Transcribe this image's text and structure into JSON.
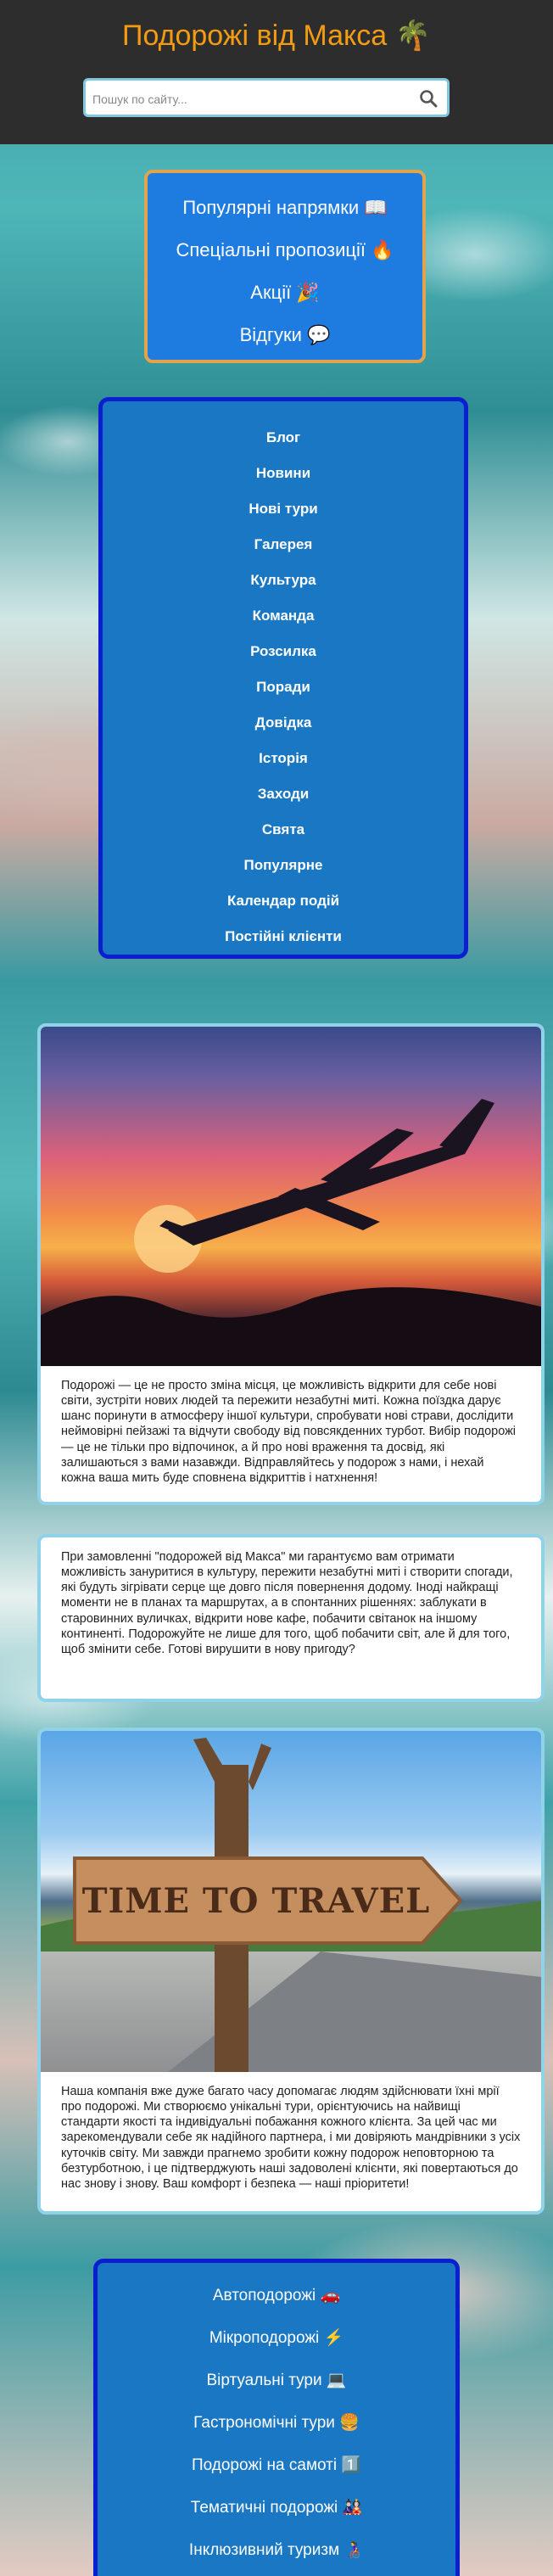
{
  "header": {
    "title": "Подорожі від Макса 🌴",
    "search_placeholder": "Пошук по сайту..."
  },
  "highlights": [
    {
      "label": "Популярні напрямки 📖"
    },
    {
      "label": "Спеціальні пропозиції 🔥"
    },
    {
      "label": "Акції 🎉"
    },
    {
      "label": "Відгуки 💬"
    }
  ],
  "nav": [
    {
      "label": "Блог"
    },
    {
      "label": "Новини"
    },
    {
      "label": "Нові тури"
    },
    {
      "label": "Галерея"
    },
    {
      "label": "Культура"
    },
    {
      "label": "Команда"
    },
    {
      "label": "Розсилка"
    },
    {
      "label": "Поради"
    },
    {
      "label": "Довідка"
    },
    {
      "label": "Історія"
    },
    {
      "label": "Заходи"
    },
    {
      "label": "Свята"
    },
    {
      "label": "Популярне"
    },
    {
      "label": "Календар подій"
    },
    {
      "label": "Постійні клієнти"
    }
  ],
  "cards": {
    "card1_text": "Подорожі — це не просто зміна місця, це можливість відкрити для себе нові світи, зустріти нових людей та пережити незабутні миті. Кожна поїздка дарує шанс поринути в атмосферу іншої культури, спробувати нові страви, дослідити неймовірні пейзажі та відчути свободу від повсякденних турбот. Вибір подорожі — це не тільки про відпочинок, а й про нові враження та досвід, які залишаються з вами назавжди. Відправляйтесь у подорож з нами, і нехай кожна ваша мить буде сповнена відкриттів і натхнення!",
    "card2_text": "При замовленні \"подорожей від Макса\" ми гарантуємо вам отримати можливість зануритися в культуру, пережити незабутні миті і створити спогади, які будуть зігрівати серце ще довго після повернення додому. Іноді найкращі моменти не в планах та маршрутах, а в спонтанних рішеннях: заблукати в старовинних вуличках, відкрити нове кафе, побачити світанок на іншому континенті. Подорожуйте не лише для того, щоб побачити світ, але й для того, щоб змінити себе. Готові вирушити в нову пригоду?",
    "sign_text": "TIME TO TRAVEL",
    "card3_text": "Наша компанія вже дуже багато часу допомагає людям здійснювати їхні мрії про подорожі. Ми створюємо унікальні тури, орієнтуючись на найвищі стандарти якості та індивідуальні побажання кожного клієнта. За цей час ми зарекомендували себе як надійного партнера, і ми довіряють мандрівники з усіх куточків світу. Ми завжди прагнемо зробити кожну подорож неповторною та безтурботною, і це підтверджують наші задоволені клієнти, які повертаються до нас знову і знову. Ваш комфорт і безпека — наші пріоритети!"
  },
  "tours": [
    {
      "label": "Автоподорожі 🚗"
    },
    {
      "label": "Мікроподорожі ⚡"
    },
    {
      "label": "Віртуальні тури 💻"
    },
    {
      "label": "Гастрономічні тури 🍔"
    },
    {
      "label": "Подорожі на самоті 1️⃣"
    },
    {
      "label": "Тематичні подорожі 🎎"
    },
    {
      "label": "Інклюзивний туризм 👩‍🦽"
    }
  ]
}
